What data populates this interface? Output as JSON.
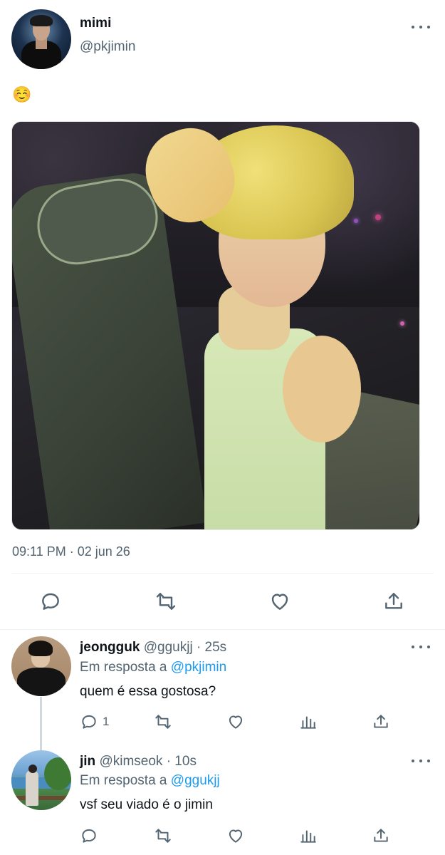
{
  "tweet": {
    "author_name": "mimi",
    "author_handle": "@pkjimin",
    "text": "☺️",
    "timestamp": "09:11 PM · 02 jun 26",
    "actions": [
      "reply-icon",
      "retweet-icon",
      "like-icon",
      "share-icon"
    ]
  },
  "replies": [
    {
      "name": "jeongguk",
      "handle_time": "@ggukjj · 25s",
      "reply_prefix": "Em resposta a ",
      "reply_to": "@pkjimin",
      "text": "quem é essa gostosa?",
      "reply_count": "1"
    },
    {
      "name": "jin",
      "handle_time": "@kimseok · 10s",
      "reply_prefix": "Em resposta a ",
      "reply_to": "@ggukjj",
      "text": "vsf seu viado é o jimin",
      "reply_count": ""
    }
  ],
  "colors": {
    "text": "#0f1419",
    "muted": "#536471",
    "link": "#1d9bf0",
    "divider": "#eff3f4"
  }
}
